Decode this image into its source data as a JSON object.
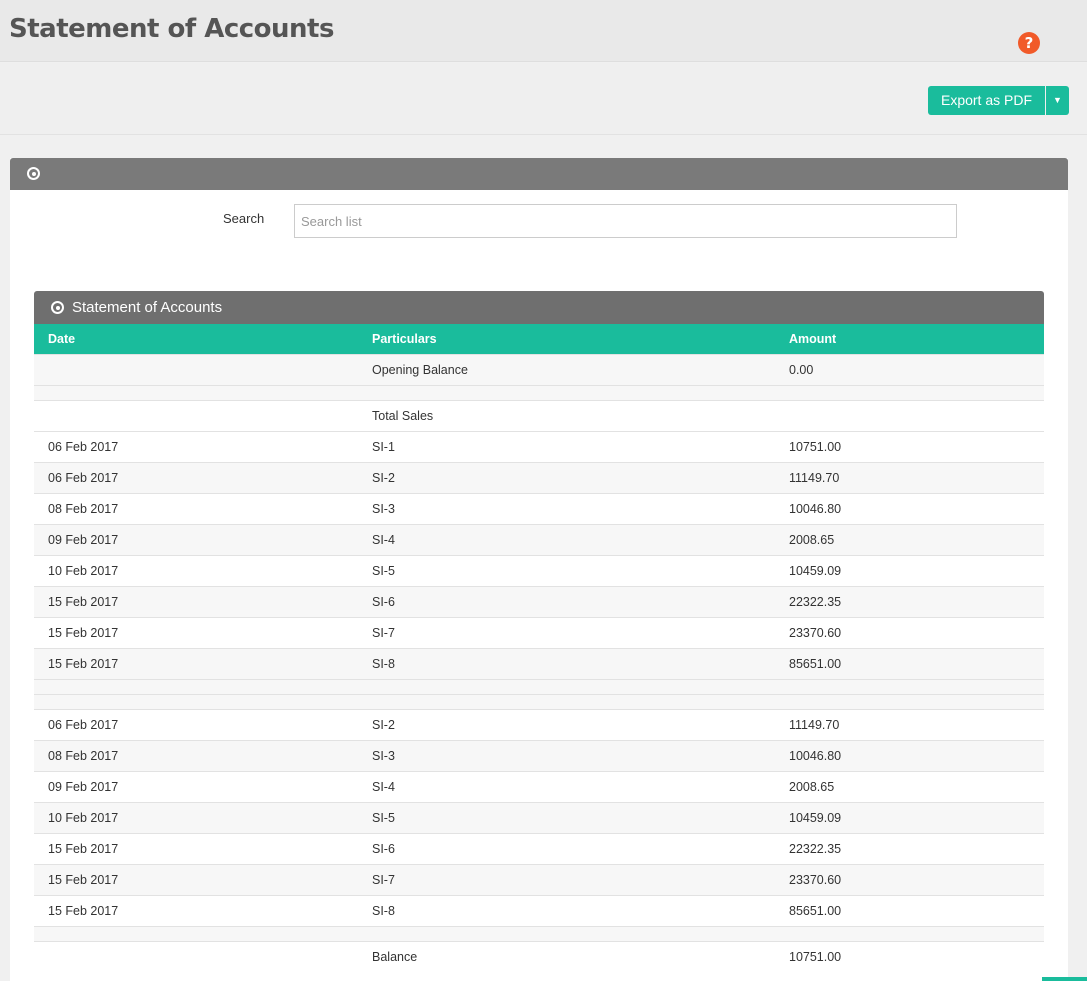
{
  "header": {
    "title": "Statement of Accounts",
    "help_icon": "help-icon"
  },
  "toolbar": {
    "export_label": "Export as PDF"
  },
  "filter": {
    "search_label": "Search",
    "search_placeholder": "Search list",
    "search_value": ""
  },
  "statement": {
    "title": "Statement of Accounts",
    "columns": [
      "Date",
      "Particulars",
      "Amount"
    ],
    "rows": [
      {
        "date": "",
        "particulars": "Opening Balance",
        "amount": "0.00",
        "style": "alt"
      },
      {
        "date": "",
        "particulars": "",
        "amount": "",
        "style": "empty"
      },
      {
        "date": "",
        "particulars": "Total Sales",
        "amount": "",
        "style": "plain"
      },
      {
        "date": "06 Feb 2017",
        "particulars": "SI-1",
        "amount": "10751.00",
        "style": "plain"
      },
      {
        "date": "06 Feb 2017",
        "particulars": "SI-2",
        "amount": "11149.70",
        "style": "alt"
      },
      {
        "date": "08 Feb 2017",
        "particulars": "SI-3",
        "amount": "10046.80",
        "style": "plain"
      },
      {
        "date": "09 Feb 2017",
        "particulars": "SI-4",
        "amount": "2008.65",
        "style": "alt"
      },
      {
        "date": "10 Feb 2017",
        "particulars": "SI-5",
        "amount": "10459.09",
        "style": "plain"
      },
      {
        "date": "15 Feb 2017",
        "particulars": "SI-6",
        "amount": "22322.35",
        "style": "alt"
      },
      {
        "date": "15 Feb 2017",
        "particulars": "SI-7",
        "amount": "23370.60",
        "style": "plain"
      },
      {
        "date": "15 Feb 2017",
        "particulars": "SI-8",
        "amount": "85651.00",
        "style": "alt"
      },
      {
        "date": "",
        "particulars": "",
        "amount": "",
        "style": "empty"
      },
      {
        "date": "",
        "particulars": "",
        "amount": "",
        "style": "empty"
      },
      {
        "date": "06 Feb 2017",
        "particulars": "SI-2",
        "amount": "11149.70",
        "style": "plain"
      },
      {
        "date": "08 Feb 2017",
        "particulars": "SI-3",
        "amount": "10046.80",
        "style": "alt"
      },
      {
        "date": "09 Feb 2017",
        "particulars": "SI-4",
        "amount": "2008.65",
        "style": "plain"
      },
      {
        "date": "10 Feb 2017",
        "particulars": "SI-5",
        "amount": "10459.09",
        "style": "alt"
      },
      {
        "date": "15 Feb 2017",
        "particulars": "SI-6",
        "amount": "22322.35",
        "style": "plain"
      },
      {
        "date": "15 Feb 2017",
        "particulars": "SI-7",
        "amount": "23370.60",
        "style": "alt"
      },
      {
        "date": "15 Feb 2017",
        "particulars": "SI-8",
        "amount": "85651.00",
        "style": "plain"
      },
      {
        "date": "",
        "particulars": "",
        "amount": "",
        "style": "empty"
      },
      {
        "date": "",
        "particulars": "Balance",
        "amount": "10751.00",
        "style": "plain"
      }
    ]
  },
  "colors": {
    "accent": "#1abc9c",
    "panel_header": "#7a7a7a",
    "help": "#f15a29"
  }
}
